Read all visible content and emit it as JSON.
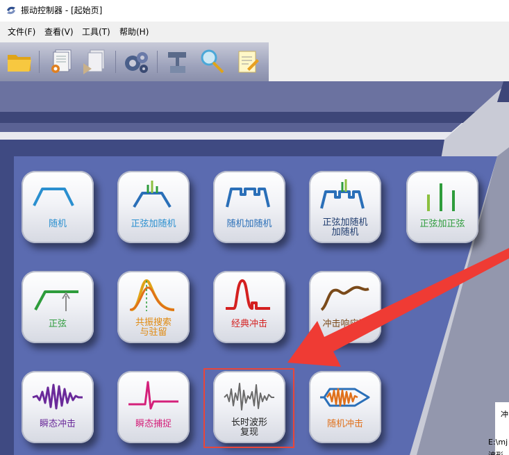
{
  "window": {
    "title": "振动控制器 - [起始页]"
  },
  "menu": {
    "items": [
      "文件(F)",
      "查看(V)",
      "工具(T)",
      "帮助(H)"
    ]
  },
  "toolbar": {
    "buttons": [
      "open-folder-icon",
      "settings-document-icon",
      "run-document-icon",
      "gears-icon",
      "monitor-icon",
      "search-edit-icon",
      "note-edit-icon"
    ]
  },
  "tiles": {
    "random": {
      "label": "随机",
      "color": "#2a8fcf"
    },
    "sine_on_random": {
      "label": "正弦加随机",
      "color": "#2a8fcf"
    },
    "random_on_random": {
      "label": "随机加随机",
      "color": "#2a8fcf"
    },
    "sine_random_random": {
      "label_line1": "正弦加随机",
      "label_line2": "加随机",
      "color": "#1f3c6e"
    },
    "sine_on_sine": {
      "label": "正弦加正弦",
      "color": "#2e9c3c"
    },
    "sine": {
      "label": "正弦",
      "color": "#2e9c3c"
    },
    "resonance": {
      "label_line1": "共振搜索",
      "label_line2": "与驻留",
      "color": "#e08a10"
    },
    "classic_shock": {
      "label": "经典冲击",
      "color": "#d42020"
    },
    "shock_response": {
      "label": "冲击响应谱",
      "color": "#7a4a1a"
    },
    "transient_shock": {
      "label": "瞬态冲击",
      "color": "#6a2a9a"
    },
    "transient_capture": {
      "label": "瞬态捕捉",
      "color": "#d4207a"
    },
    "long_waveform": {
      "label_line1": "长时波形",
      "label_line2": "复现",
      "color": "#222222"
    },
    "random_shock": {
      "label": "随机冲击",
      "color": "#e0701a"
    }
  },
  "side_panel": {
    "tab": "冲",
    "line1": "E:\\mj",
    "line2": "波形"
  }
}
